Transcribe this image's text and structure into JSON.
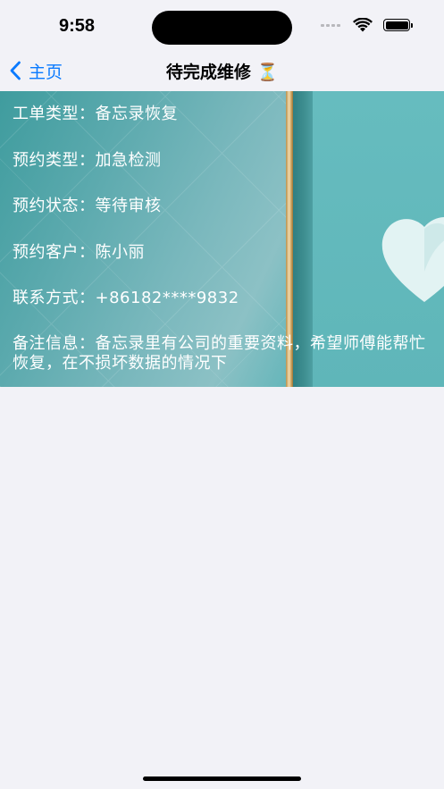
{
  "status_bar": {
    "time": "9:58"
  },
  "nav": {
    "back_label": "主页",
    "title": "待完成维修 ⏳"
  },
  "order": {
    "rows": [
      {
        "label": "工单类型：",
        "value": "备忘录恢复"
      },
      {
        "label": "预约类型：",
        "value": "加急检测"
      },
      {
        "label": "预约状态：",
        "value": "等待审核"
      },
      {
        "label": "预约客户：",
        "value": "陈小丽"
      },
      {
        "label": "联系方式：",
        "value": "+86182****9832"
      },
      {
        "label": "备注信息：",
        "value": "备忘录里有公司的重要资料，希望师傅能帮忙恢复，在不损坏数据的情况下"
      }
    ]
  },
  "icons": {
    "back": "chevron-left-icon",
    "wifi": "wifi-icon",
    "battery": "battery-icon",
    "signal": "cellular-signal-icon"
  },
  "colors": {
    "background": "#f2f2f7",
    "accent": "#0a7aff",
    "card_text": "#ffffff"
  }
}
